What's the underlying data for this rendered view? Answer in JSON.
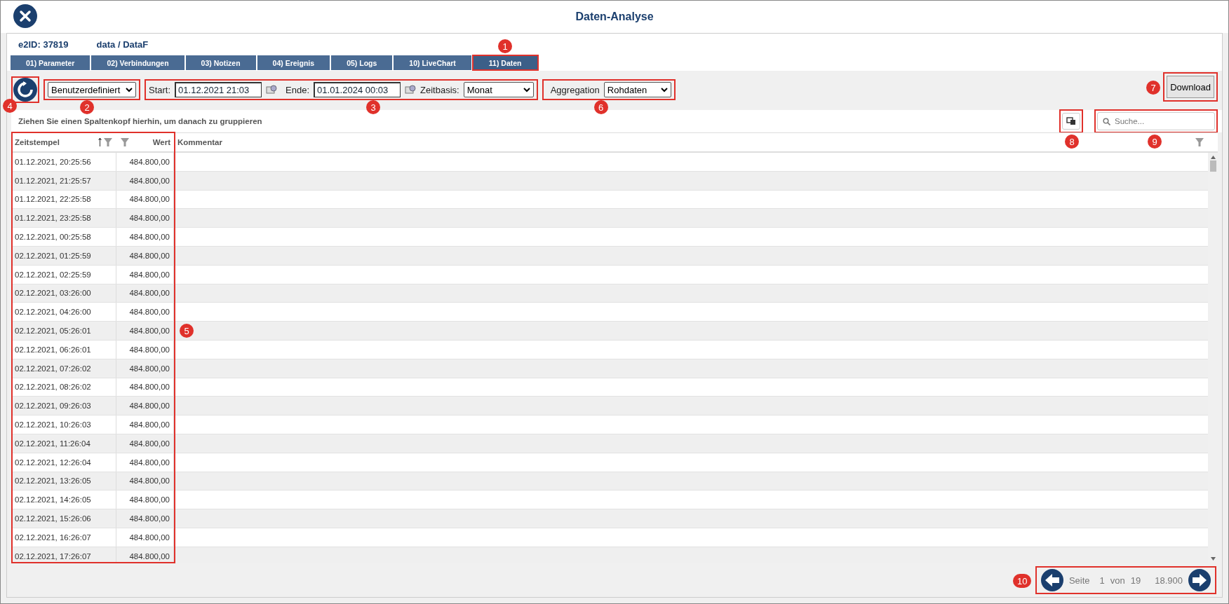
{
  "window": {
    "title": "Daten-Analyse"
  },
  "header": {
    "id_label": "e2ID: 37819",
    "path": "data / DataF"
  },
  "tabs": [
    {
      "label": "01) Parameter",
      "selected": false
    },
    {
      "label": "02) Verbindungen",
      "selected": false
    },
    {
      "label": "03) Notizen",
      "selected": false
    },
    {
      "label": "04) Ereignis",
      "selected": false
    },
    {
      "label": "05) Logs",
      "selected": false
    },
    {
      "label": "10) LiveChart",
      "selected": false
    },
    {
      "label": "11) Daten",
      "selected": true
    }
  ],
  "callouts": {
    "tabs": "1",
    "range": "2",
    "dates": "3",
    "refresh": "4",
    "table": "5",
    "aggregation": "6",
    "download": "7",
    "columns": "8",
    "search": "9",
    "pager": "10"
  },
  "toolbar": {
    "range_select": "Benutzerdefiniert",
    "start_label": "Start:",
    "start_value": "01.12.2021 21:03",
    "end_label": "Ende:",
    "end_value": "01.01.2024 00:03",
    "basis_label": "Zeitbasis:",
    "basis_value": "Monat",
    "aggregation_label": "Aggregation",
    "aggregation_value": "Rohdaten",
    "download": "Download"
  },
  "group_hint": "Ziehen Sie einen Spaltenkopf hierhin, um danach zu gruppieren",
  "search": {
    "placeholder": "Suche..."
  },
  "table": {
    "columns": [
      "Zeitstempel",
      "Wert",
      "Kommentar"
    ],
    "rows": [
      [
        "01.12.2021, 20:25:56",
        "484.800,00"
      ],
      [
        "01.12.2021, 21:25:57",
        "484.800,00"
      ],
      [
        "01.12.2021, 22:25:58",
        "484.800,00"
      ],
      [
        "01.12.2021, 23:25:58",
        "484.800,00"
      ],
      [
        "02.12.2021, 00:25:58",
        "484.800,00"
      ],
      [
        "02.12.2021, 01:25:59",
        "484.800,00"
      ],
      [
        "02.12.2021, 02:25:59",
        "484.800,00"
      ],
      [
        "02.12.2021, 03:26:00",
        "484.800,00"
      ],
      [
        "02.12.2021, 04:26:00",
        "484.800,00"
      ],
      [
        "02.12.2021, 05:26:01",
        "484.800,00"
      ],
      [
        "02.12.2021, 06:26:01",
        "484.800,00"
      ],
      [
        "02.12.2021, 07:26:02",
        "484.800,00"
      ],
      [
        "02.12.2021, 08:26:02",
        "484.800,00"
      ],
      [
        "02.12.2021, 09:26:03",
        "484.800,00"
      ],
      [
        "02.12.2021, 10:26:03",
        "484.800,00"
      ],
      [
        "02.12.2021, 11:26:04",
        "484.800,00"
      ],
      [
        "02.12.2021, 12:26:04",
        "484.800,00"
      ],
      [
        "02.12.2021, 13:26:05",
        "484.800,00"
      ],
      [
        "02.12.2021, 14:26:05",
        "484.800,00"
      ],
      [
        "02.12.2021, 15:26:06",
        "484.800,00"
      ],
      [
        "02.12.2021, 16:26:07",
        "484.800,00"
      ],
      [
        "02.12.2021, 17:26:07",
        "484.800,00"
      ]
    ]
  },
  "pager": {
    "label": "Seite",
    "page": "1",
    "of": "von",
    "pages": "19",
    "total": "18.900"
  }
}
